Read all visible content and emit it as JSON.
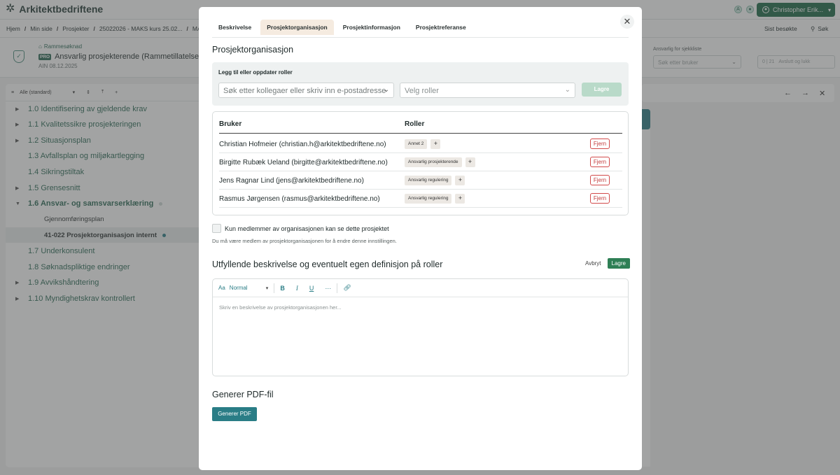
{
  "app": {
    "name": "Arkitektbedriftene",
    "user_button": "Christopher Erik..."
  },
  "breadcrumbs": [
    "Hjem",
    "Min side",
    "Prosjekter",
    "25022026 - MAKS kurs 25.02...",
    "MAKS"
  ],
  "crumb_actions": {
    "recent": "Sist besøkte",
    "search": "Søk"
  },
  "header": {
    "type": "Rammesøknad",
    "badge": "PRO",
    "title": "Ansvarlig prosjekterende (Rammetillatelse)",
    "subtitle": "AIN 08.12.2025",
    "responsible_label": "Ansvarlig for sjekkliste",
    "responsible_placeholder": "Søk etter bruker",
    "status_count": "0 | 21",
    "status_label": "Avslutt og lukk"
  },
  "tree": {
    "filter_label": "Alle (standard)",
    "items": [
      {
        "label": "1.0 Identifisering av gjeldende krav"
      },
      {
        "label": "1.1 Kvalitetssikre prosjekteringen"
      },
      {
        "label": "1.2 Situasjonsplan"
      },
      {
        "label": "1.3 Avfallsplan og miljøkartlegging"
      },
      {
        "label": "1.4 Sikringstiltak"
      },
      {
        "label": "1.5 Grensesnitt"
      },
      {
        "label": "1.6 Ansvar- og samsvarserklæring"
      },
      {
        "label": "Gjennomføringsplan"
      },
      {
        "label": "41-022 Prosjektorganisasjon internt"
      },
      {
        "label": "1.7 Underkonsulent"
      },
      {
        "label": "1.8 Søknadspliktige endringer"
      },
      {
        "label": "1.9 Avvikshåndtering"
      },
      {
        "label": "1.10 Myndighetskrav kontrollert"
      }
    ]
  },
  "modal": {
    "tabs": [
      "Beskrivelse",
      "Prosjektorganisasjon",
      "Prosjektinformasjon",
      "Prosjektreferanse"
    ],
    "section_title": "Prosjektorganisasjon",
    "add": {
      "label": "Legg til eller oppdater roller",
      "search_placeholder": "Søk etter kollegaer eller skriv inn e-postadresse",
      "role_placeholder": "Velg roller",
      "button": "Lagre"
    },
    "table": {
      "col_user": "Bruker",
      "col_roles": "Roller",
      "remove_label": "Fjern",
      "rows": [
        {
          "user": "Christian Hofmeier  (christian.h@arkitektbedriftene.no)",
          "role": "Annet 2"
        },
        {
          "user": "Birgitte Rubæk Ueland  (birgitte@arkitektbedriftene.no)",
          "role": "Ansvarlig prosjekterende"
        },
        {
          "user": "Jens Ragnar Lind  (jens@arkitektbedriftene.no)",
          "role": "Ansvarlig regulering"
        },
        {
          "user": "Rasmus Jørgensen  (rasmus@arkitektbedriftene.no)",
          "role": "Ansvarlig regulering"
        }
      ]
    },
    "members_only": {
      "label": "Kun medlemmer av organisasjonen kan se dette prosjektet",
      "help": "Du må være medlem av prosjektorganisasjonen for å endre denne innstillingen."
    },
    "description": {
      "title": "Utfyllende beskrivelse og eventuelt egen definisjon på roller",
      "cancel": "Avbryt",
      "save": "Lagre",
      "text_style": "Normal",
      "placeholder": "Skriv en beskrivelse av prosjektorganisasjonen her..."
    },
    "pdf": {
      "title": "Generer PDF-fil",
      "button": "Generer PDF"
    }
  },
  "colors": {
    "brand_green": "#1e6a48",
    "teal": "#2a7d86",
    "danger": "#c23b3b",
    "active_tab": "#f5ebe0"
  }
}
